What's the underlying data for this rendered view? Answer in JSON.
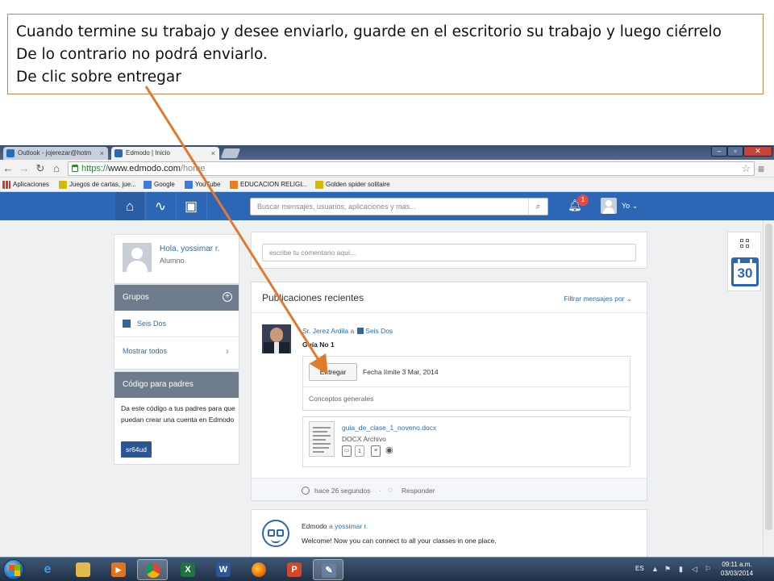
{
  "callout": {
    "line1": "Cuando termine su trabajo y desee enviarlo, guarde en el escritorio su trabajo y luego ciérrelo",
    "line2": "De lo contrario no podrá enviarlo.",
    "line3": "De clic sobre entregar"
  },
  "browser": {
    "tabs": [
      {
        "label": "Outlook - jojerezar@hotm",
        "close": "×"
      },
      {
        "label": "Edmodo | Inicio",
        "close": "×"
      }
    ],
    "url_scheme": "https://",
    "url_host": "www.edmodo.com",
    "url_path": "/home",
    "bookmarks": [
      "Aplicaciones",
      "Juegos de cartas, jue...",
      "Google",
      "YouTube",
      "EDUCACION RELIGI...",
      "Golden spider solitaire"
    ]
  },
  "edmodo": {
    "search_placeholder": "Buscar mensajes, usuarios, aplicaciones y mas...",
    "notification_count": "1",
    "user_menu": "Yo",
    "profile": {
      "hello": "Hola, yossimar r.",
      "role": "Alumno"
    },
    "groups": {
      "title": "Grupos",
      "items": [
        "Seis Dos"
      ],
      "show_all": "Mostrar todos"
    },
    "parents": {
      "title": "Código para padres",
      "text": "Da este código a tus padres para que puedan crear una cuenta en Edmodo",
      "code": "sr64ud"
    },
    "comment_placeholder": "escribe tu comentario aquí...",
    "posts": {
      "title": "Publicaciones recientes",
      "filter": "Filtrar mensajes por",
      "author": "Sr. Jerez Ardila",
      "connector": "a",
      "group": "Seis Dos",
      "post_title": "Guía No 1",
      "turn_in": "Entregar",
      "due": "Fecha límite 3 Mar, 2014",
      "description": "Conceptos generales",
      "file_name": "guia_de_clase_1_noveno.docx",
      "file_type": "DOCX Archivo",
      "file_count": "1",
      "time_ago": "hace 26 segundos",
      "separator": "·",
      "reply": "Responder"
    },
    "welcome": {
      "sender": "Edmodo",
      "connector": "a",
      "recipient": "yossimar r.",
      "message": "Welcome! Now you can connect to all your classes in one place."
    },
    "calendar_day": "30"
  },
  "taskbar": {
    "language": "ES",
    "time": "09:11 a.m.",
    "date": "03/03/2014"
  },
  "colors": {
    "edmodo_blue": "#2d66b4",
    "arrow_orange": "#e07a2e",
    "callout_border": "#c8824a"
  }
}
